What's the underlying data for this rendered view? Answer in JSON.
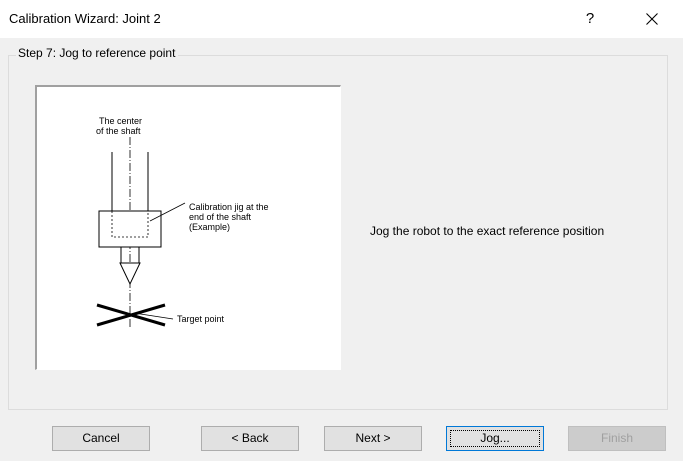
{
  "window": {
    "title": "Calibration Wizard: Joint 2",
    "help_label": "?"
  },
  "step": {
    "legend": "Step 7: Jog to reference point",
    "instruction": "Jog the robot to the exact reference position"
  },
  "diagram": {
    "center_label_line1": "The center",
    "center_label_line2": "of the shaft",
    "jig_label_line1": "Calibration jig at the",
    "jig_label_line2": "end of the shaft",
    "jig_label_line3": "(Example)",
    "target_label": "Target point"
  },
  "buttons": {
    "cancel": "Cancel",
    "back": "< Back",
    "next": "Next >",
    "jog": "Jog...",
    "finish": "Finish"
  }
}
